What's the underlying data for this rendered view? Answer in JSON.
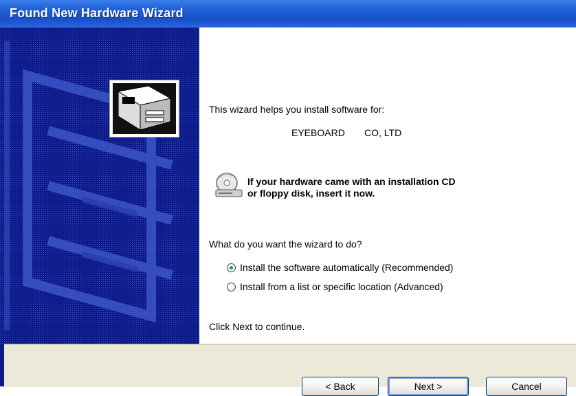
{
  "window": {
    "title": "Found New Hardware Wizard"
  },
  "content": {
    "intro": "This wizard helps you install software for:",
    "device_name": "EYEBOARD",
    "device_company": "CO, LTD",
    "cd_notice": "If your hardware came with an installation CD\nor floppy disk, insert it now.",
    "question": "What do you want the wizard to do?",
    "options": [
      {
        "label": "Install the software automatically (Recommended)",
        "selected": true
      },
      {
        "label": "Install from a list or specific location (Advanced)",
        "selected": false
      }
    ],
    "continue_text": "Click Next to continue."
  },
  "buttons": {
    "back": "< Back",
    "next": "Next >",
    "cancel": "Cancel"
  },
  "colors": {
    "title_bar": "#1f5fd8",
    "side_panel": "#0c1a8a",
    "footer": "#ece9d8",
    "radio_dot": "#21a121"
  },
  "icons": [
    "hardware-card-icon",
    "cd-drive-icon"
  ]
}
